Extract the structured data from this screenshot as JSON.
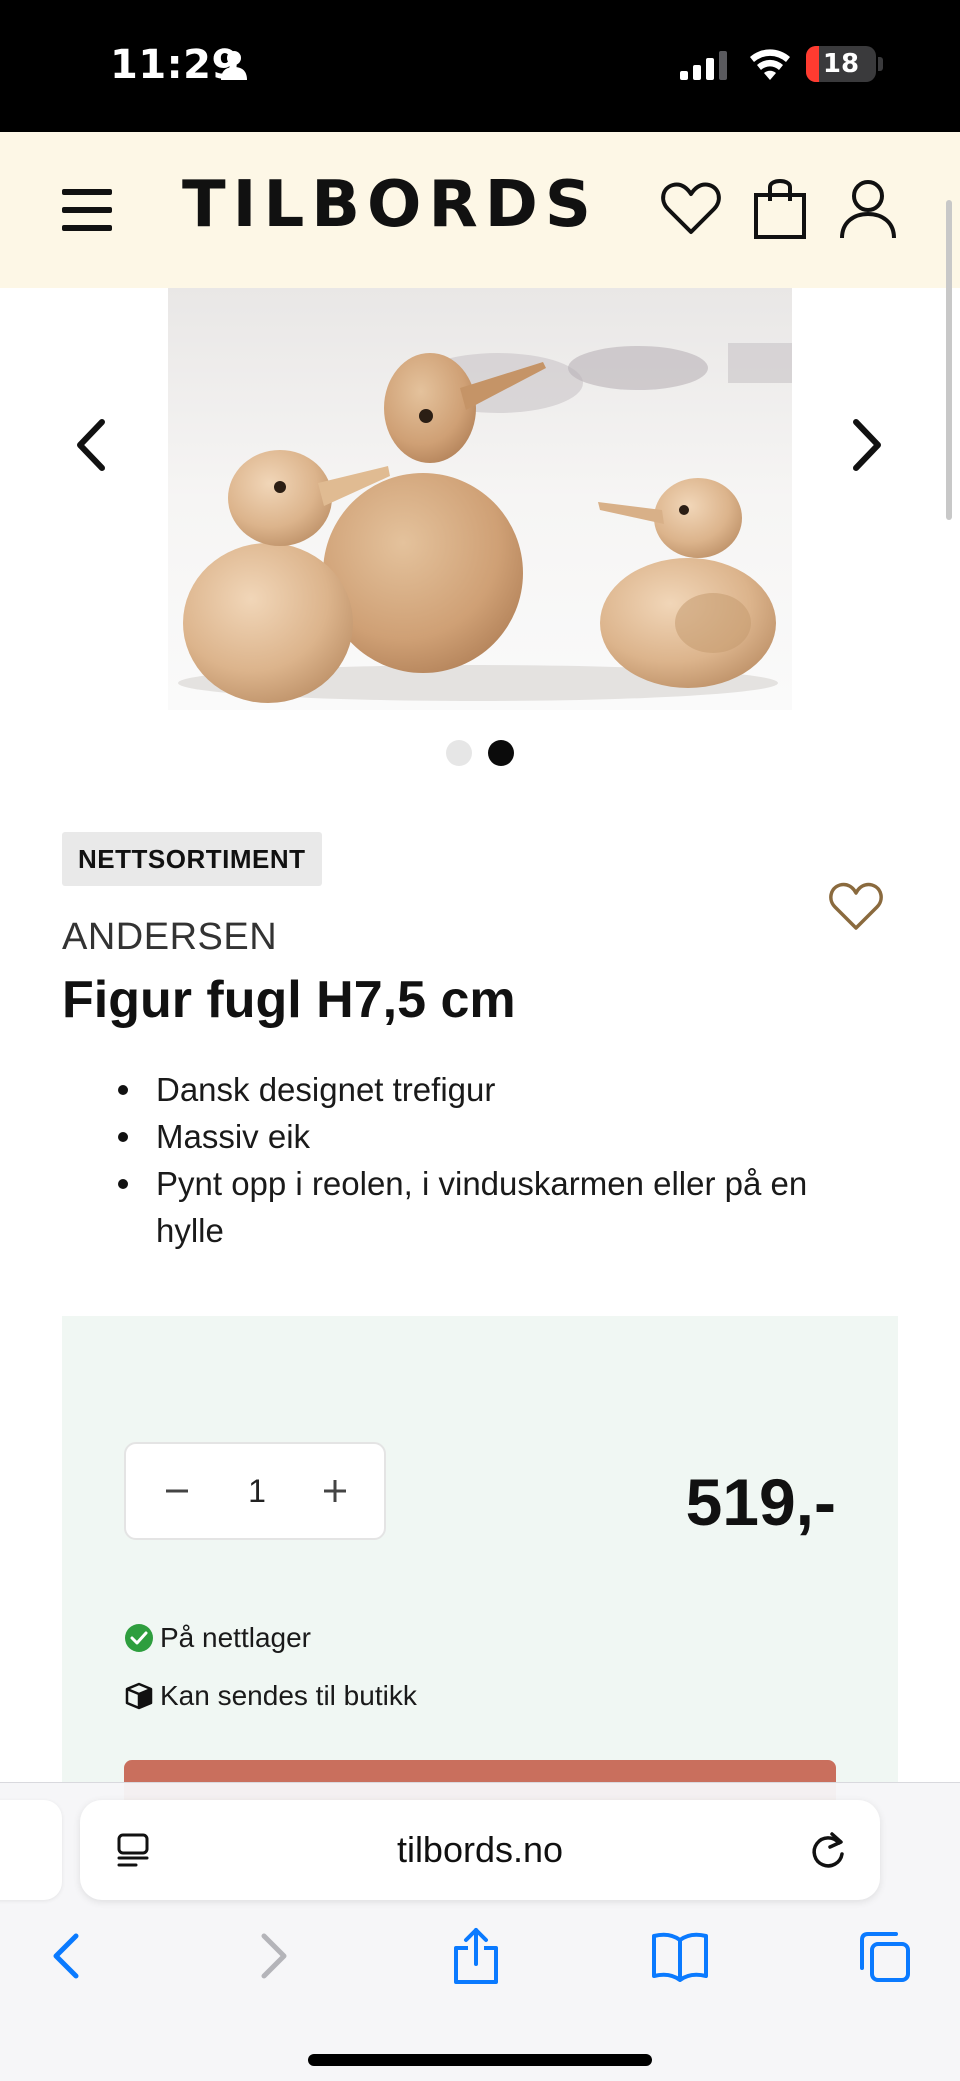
{
  "status_bar": {
    "time": "11:29",
    "battery": "18",
    "battery_level": 0.18
  },
  "header": {
    "logo": "TILBORDS"
  },
  "gallery": {
    "image_alt": "Wooden bird figures",
    "slide_count": 2,
    "active_slide": 2
  },
  "product": {
    "badge": "NETTSORTIMENT",
    "brand": "ANDERSEN",
    "title": "Figur fugl H7,5 cm",
    "features": [
      "Dansk designet trefigur",
      "Massiv eik",
      "Pynt opp i reolen, i vinduskarmen eller på en hylle"
    ]
  },
  "buy_box": {
    "quantity": "1",
    "price": "519,-",
    "stock_status": "På nettlager",
    "shipping_status": "Kan sendes til butikk"
  },
  "browser": {
    "url": "tilbords.no"
  },
  "colors": {
    "header_bg": "#fdf7e6",
    "buy_box_bg": "#f0f7f3",
    "add_to_cart": "#c96f5d",
    "wishlist_heart": "#8a6a3e",
    "in_stock_green": "#2e9e3e",
    "safari_blue": "#0a7aff"
  }
}
